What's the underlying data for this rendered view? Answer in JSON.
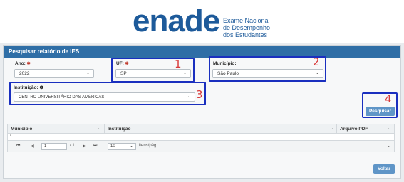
{
  "brand": {
    "logo": "enade",
    "tagline_1": "Exame Nacional",
    "tagline_2": "de Desempenho",
    "tagline_3": "dos Estudantes"
  },
  "panel": {
    "title": "Pesquisar relatório de IES"
  },
  "form": {
    "ano": {
      "label": "Ano:",
      "value": "2022"
    },
    "uf": {
      "label": "UF:",
      "value": "SP"
    },
    "municipio": {
      "label": "Município:",
      "value": "São Paulo"
    },
    "instituicao": {
      "label": "Instituição:",
      "value": "CENTRO UNIVERSITÁRIO DAS AMÉRICAS"
    },
    "required_mark": "✱",
    "info_mark": "❶"
  },
  "annotations": {
    "n1": "1",
    "n2": "2",
    "n3": "3",
    "n4": "4"
  },
  "buttons": {
    "pesquisar": "Pesquisar",
    "voltar": "Voltar"
  },
  "grid": {
    "columns": [
      "Município",
      "Instituição",
      "Arquivo PDF"
    ],
    "page": "1",
    "total_pages": "/ 1",
    "page_size": "10",
    "page_size_suffix": "itens/pág."
  },
  "icons": {
    "first": "⏮",
    "prev": "◀",
    "next": "▶",
    "last": "⏭",
    "chevron": "⌄",
    "scroll_left": "‹",
    "scroll_down": "⌄"
  },
  "colors": {
    "brand": "#1d5a9a",
    "panel_header": "#2f6ea6",
    "annotation_box": "#1a2fbf",
    "annotation_number": "#d93a3a"
  }
}
